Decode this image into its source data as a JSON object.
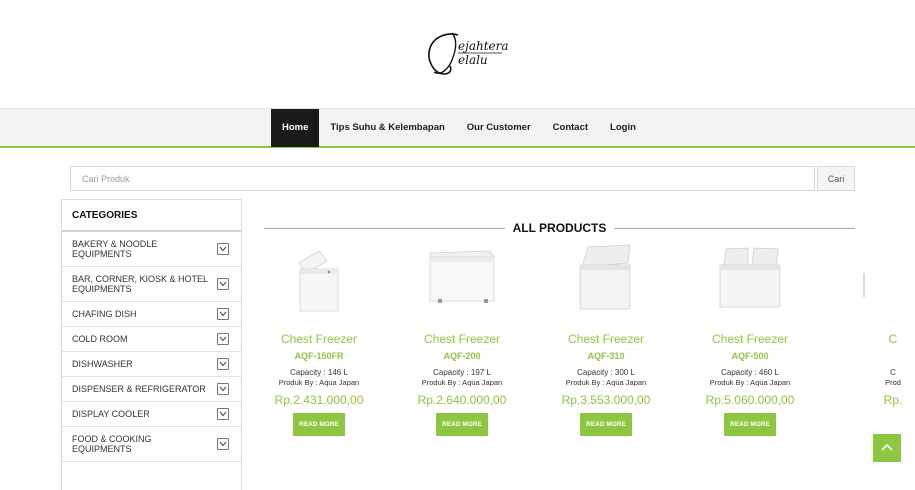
{
  "logo": {
    "alt": "Sejahtera Selalu"
  },
  "nav": {
    "items": [
      {
        "label": "Home",
        "active": true
      },
      {
        "label": "Tips Suhu & Kelembapan",
        "active": false
      },
      {
        "label": "Our Customer",
        "active": false
      },
      {
        "label": "Contact",
        "active": false
      },
      {
        "label": "Login",
        "active": false
      }
    ]
  },
  "search": {
    "placeholder": "Cari Produk",
    "value": "",
    "button_label": "Cari"
  },
  "categories": {
    "title": "CATEGORIES",
    "items": [
      {
        "label": "BAKERY & NOODLE EQUIPMENTS"
      },
      {
        "label": "BAR, CORNER, KIOSK & HOTEL EQUIPMENTS"
      },
      {
        "label": "CHAFING DISH"
      },
      {
        "label": "COLD ROOM"
      },
      {
        "label": "DISHWASHER"
      },
      {
        "label": "DISPENSER & REFRIGERATOR"
      },
      {
        "label": "DISPLAY COOLER"
      },
      {
        "label": "FOOD & COOKING EQUIPMENTS"
      }
    ]
  },
  "products_section": {
    "title": "ALL PRODUCTS"
  },
  "products": [
    {
      "name": "Chest Freezer",
      "model": "AQF-150FR",
      "capacity": "Capacity : 146 L",
      "by": "Produk By : Aqua Japan",
      "price": "Rp.2.431.000,00",
      "button": "READ MORE"
    },
    {
      "name": "Chest Freezer",
      "model": "AQF-200",
      "capacity": "Capacity : 197 L",
      "by": "Produk By : Aqua Japan",
      "price": "Rp.2.640.000,00",
      "button": "READ MORE"
    },
    {
      "name": "Chest Freezer",
      "model": "AQF-310",
      "capacity": "Capacity : 300 L",
      "by": "Produk By : Aqua Japan",
      "price": "Rp.3.553.000,00",
      "button": "READ MORE"
    },
    {
      "name": "Chest Freezer",
      "model": "AQF-500",
      "capacity": "Capacity : 460 L",
      "by": "Produk By : Aqua Japan",
      "price": "Rp.5.060.000,00",
      "button": "READ MORE"
    },
    {
      "name": "C",
      "model": "",
      "capacity": "C",
      "by": "Prod",
      "price": "Rp.",
      "button": ""
    }
  ],
  "colors": {
    "accent": "#8dc63f",
    "nav_active_bg": "#1a1a1a",
    "text": "#222222"
  },
  "icons": {
    "chevron": "chevron-down-icon",
    "back_to_top": "arrow-up-icon"
  }
}
